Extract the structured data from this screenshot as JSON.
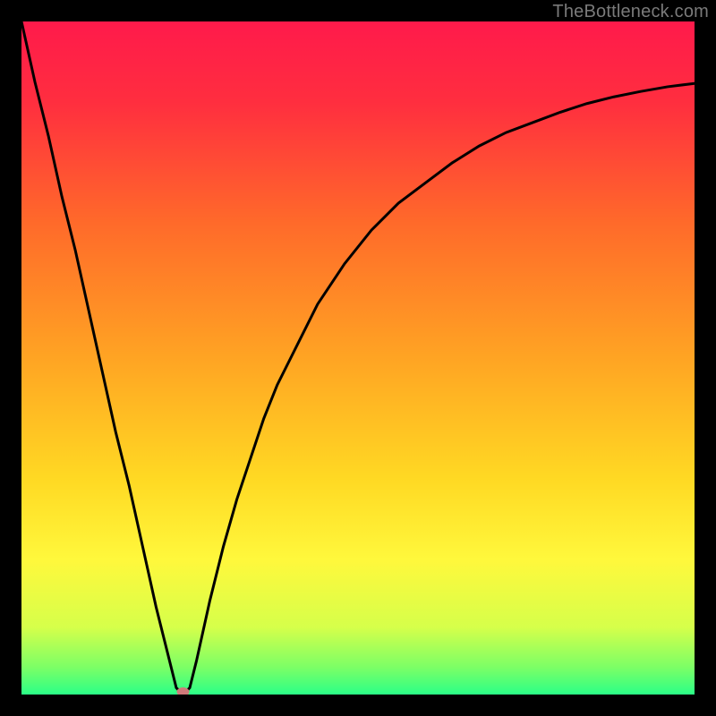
{
  "watermark": "TheBottleneck.com",
  "chart_data": {
    "type": "line",
    "title": "",
    "xlabel": "",
    "ylabel": "",
    "xlim": [
      0,
      100
    ],
    "ylim": [
      0,
      100
    ],
    "grid": false,
    "legend": false,
    "gradient_stops": [
      {
        "offset": 0,
        "color": "#ff1a4b"
      },
      {
        "offset": 12,
        "color": "#ff2e3f"
      },
      {
        "offset": 30,
        "color": "#ff6a2a"
      },
      {
        "offset": 50,
        "color": "#ffa423"
      },
      {
        "offset": 68,
        "color": "#ffd923"
      },
      {
        "offset": 80,
        "color": "#fff83c"
      },
      {
        "offset": 90,
        "color": "#d6ff4a"
      },
      {
        "offset": 96,
        "color": "#7bff66"
      },
      {
        "offset": 100,
        "color": "#2bff87"
      }
    ],
    "series": [
      {
        "name": "curve",
        "stroke": "#000000",
        "x": [
          0,
          2,
          4,
          6,
          8,
          10,
          12,
          14,
          16,
          18,
          20,
          22,
          23,
          24,
          25,
          26,
          28,
          30,
          32,
          34,
          36,
          38,
          40,
          44,
          48,
          52,
          56,
          60,
          64,
          68,
          72,
          76,
          80,
          84,
          88,
          92,
          96,
          100
        ],
        "y": [
          100,
          91,
          83,
          74,
          66,
          57,
          48,
          39,
          31,
          22,
          13,
          5,
          1,
          0,
          1,
          5,
          14,
          22,
          29,
          35,
          41,
          46,
          50,
          58,
          64,
          69,
          73,
          76,
          79,
          81.5,
          83.5,
          85,
          86.5,
          87.8,
          88.8,
          89.6,
          90.3,
          90.8
        ]
      }
    ],
    "marker": {
      "x": 24,
      "y": 0,
      "rx": 7,
      "ry": 5,
      "fill": "#cf7a7a"
    }
  }
}
